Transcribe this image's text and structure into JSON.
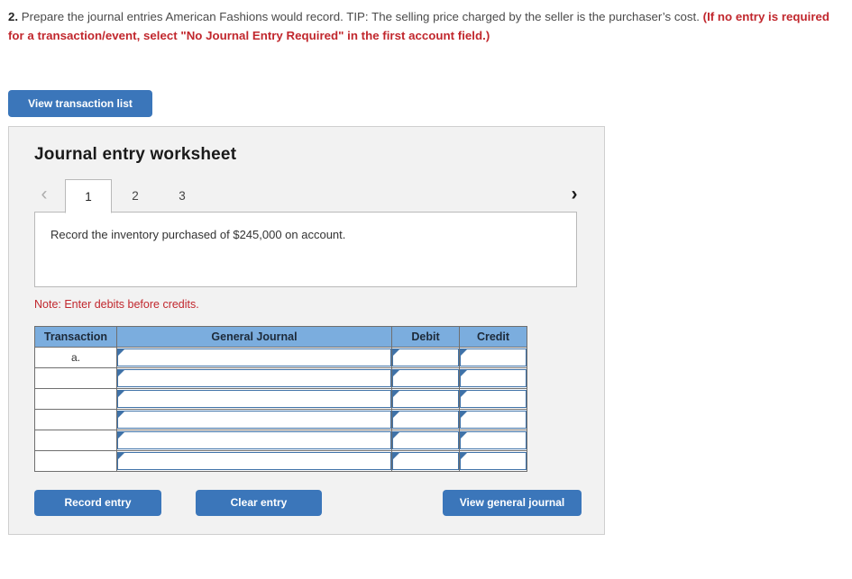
{
  "prompt": {
    "number": "2.",
    "black_text": "Prepare the journal entries American Fashions would record. TIP: The selling price charged by the seller is the purchaser’s cost.",
    "red_text": "(If no entry is required for a transaction/event, select \"No Journal Entry Required\" in the first account field.)"
  },
  "toolbar": {
    "view_transaction_list_label": "View transaction list"
  },
  "worksheet": {
    "title": "Journal entry worksheet",
    "nav": {
      "prev_icon": "‹",
      "next_icon": "›"
    },
    "tabs": [
      {
        "label": "1",
        "active": true
      },
      {
        "label": "2",
        "active": false
      },
      {
        "label": "3",
        "active": false
      }
    ],
    "instruction": "Record the inventory purchased of $245,000 on account.",
    "note": "Note: Enter debits before credits.",
    "table": {
      "headers": [
        "Transaction",
        "General Journal",
        "Debit",
        "Credit"
      ],
      "rows": [
        {
          "transaction": "a.",
          "general_journal": "",
          "debit": "",
          "credit": ""
        },
        {
          "transaction": "",
          "general_journal": "",
          "debit": "",
          "credit": ""
        },
        {
          "transaction": "",
          "general_journal": "",
          "debit": "",
          "credit": ""
        },
        {
          "transaction": "",
          "general_journal": "",
          "debit": "",
          "credit": ""
        },
        {
          "transaction": "",
          "general_journal": "",
          "debit": "",
          "credit": ""
        },
        {
          "transaction": "",
          "general_journal": "",
          "debit": "",
          "credit": ""
        }
      ]
    },
    "buttons": {
      "record_entry": "Record entry",
      "clear_entry": "Clear entry",
      "view_general_journal": "View general journal"
    }
  },
  "colors": {
    "button_blue": "#3b76ba",
    "table_header_blue": "#7badde",
    "input_border_blue": "#3f72a8",
    "alert_red": "#c1272d",
    "panel_bg": "#f2f2f2"
  }
}
